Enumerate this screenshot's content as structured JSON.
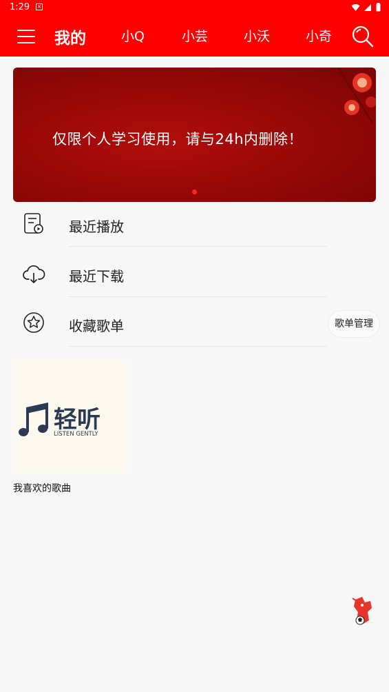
{
  "status_bar": {
    "time": "1:29"
  },
  "app_bar": {
    "active_tab": "我的",
    "tabs": [
      "小Q",
      "小芸",
      "小沃",
      "小奇"
    ]
  },
  "banner": {
    "text": "仅限个人学习使用，请与24h内删除！"
  },
  "menu": {
    "items": [
      {
        "label": "最近播放",
        "icon": "recent-play-icon"
      },
      {
        "label": "最近下载",
        "icon": "download-cloud-icon"
      },
      {
        "label": "收藏歌单",
        "icon": "star-icon"
      }
    ],
    "manage_label": "歌单管理"
  },
  "playlist": {
    "name": "我喜欢的歌曲",
    "cover_brand": "轻听",
    "cover_subtitle": "LISTEN GENTLY"
  },
  "colors": {
    "accent": "#ff0000",
    "banner": "#9a0808",
    "cover_text": "#2b3a55"
  }
}
